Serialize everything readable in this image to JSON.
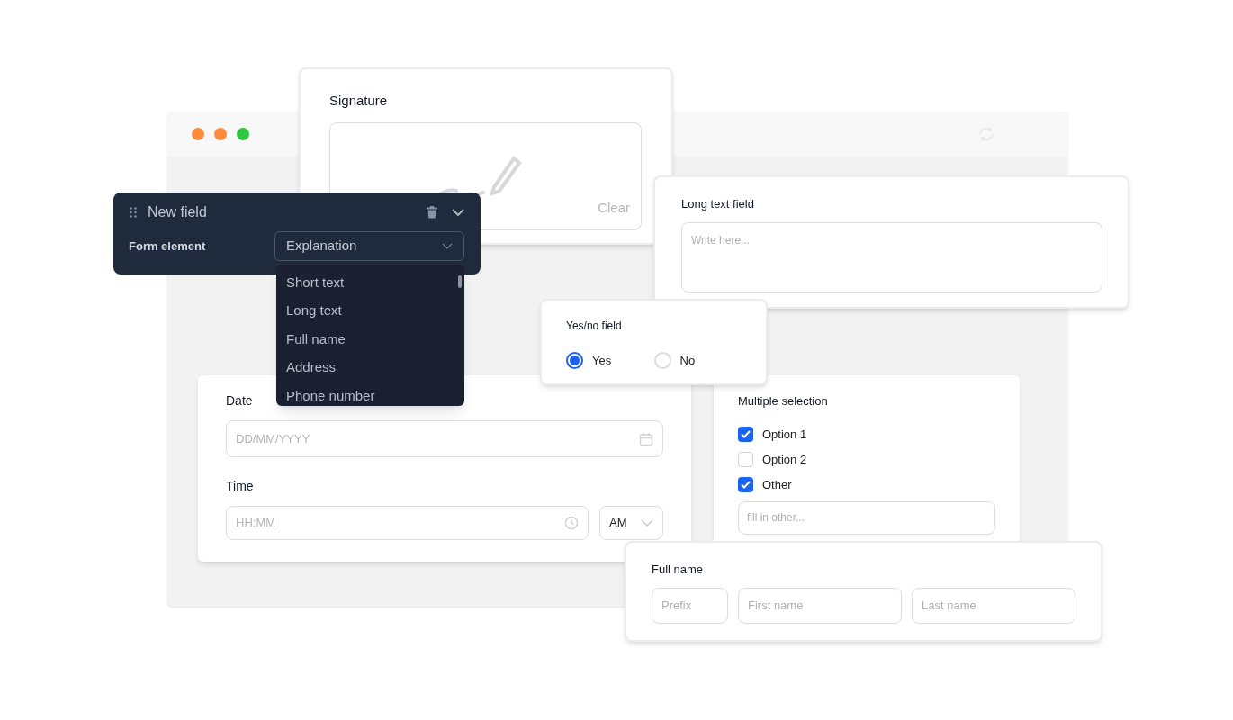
{
  "browser": {
    "dots": [
      {
        "color": "#fb8c3c"
      },
      {
        "color": "#fb8c3c"
      },
      {
        "color": "#2fc73f"
      }
    ]
  },
  "signature": {
    "title": "Signature",
    "clear": "Clear"
  },
  "date_time": {
    "date_label": "Date",
    "date_placeholder": "DD/MM/YYYY",
    "time_label": "Time",
    "time_placeholder": "HH:MM",
    "period": "AM"
  },
  "multiple_selection": {
    "title": "Multiple selection",
    "options": [
      {
        "label": "Option 1",
        "checked": true
      },
      {
        "label": "Option 2",
        "checked": false
      },
      {
        "label": "Other",
        "checked": true
      }
    ],
    "other_placeholder": "fill in other..."
  },
  "long_text": {
    "title": "Long text field",
    "placeholder": "Write here..."
  },
  "field_editor": {
    "title": "New field",
    "label": "Form element",
    "value": "Explanation",
    "options": [
      {
        "label": "Short text"
      },
      {
        "label": "Long text"
      },
      {
        "label": "Full name"
      },
      {
        "label": "Address"
      },
      {
        "label": "Phone number"
      }
    ]
  },
  "yes_no": {
    "title": "Yes/no field",
    "options": [
      {
        "label": "Yes",
        "selected": true
      },
      {
        "label": "No",
        "selected": false
      }
    ]
  },
  "full_name": {
    "title": "Full name",
    "fields": [
      {
        "placeholder": "Prefix"
      },
      {
        "placeholder": "First name"
      },
      {
        "placeholder": "Last name"
      }
    ]
  }
}
